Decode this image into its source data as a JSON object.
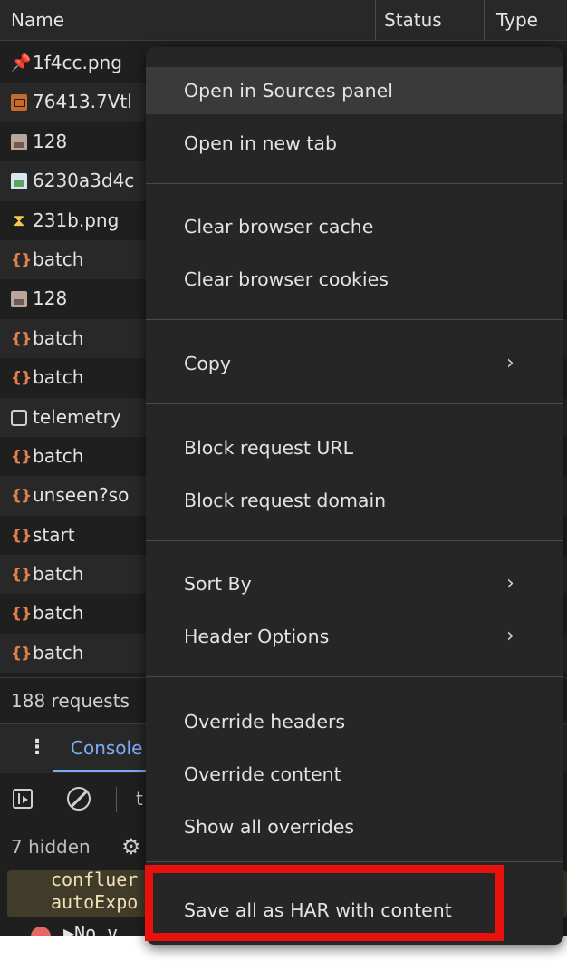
{
  "network": {
    "columns": {
      "name": "Name",
      "status": "Status",
      "type": "Type"
    },
    "rows": [
      {
        "icon": "pin-icon",
        "name": "1f4cc.png"
      },
      {
        "icon": "document-icon",
        "name": "76413.7Vtl"
      },
      {
        "icon": "image-icon",
        "name": "128"
      },
      {
        "icon": "image-icon",
        "name": "6230a3d4c"
      },
      {
        "icon": "hourglass-icon",
        "name": "231b.png"
      },
      {
        "icon": "fetch-icon",
        "name": "batch"
      },
      {
        "icon": "image-icon",
        "name": "128"
      },
      {
        "icon": "fetch-icon",
        "name": "batch"
      },
      {
        "icon": "fetch-icon",
        "name": "batch"
      },
      {
        "icon": "checkbox-icon",
        "name": "telemetry"
      },
      {
        "icon": "fetch-icon",
        "name": "batch"
      },
      {
        "icon": "fetch-icon",
        "name": "unseen?so"
      },
      {
        "icon": "fetch-icon",
        "name": "start"
      },
      {
        "icon": "fetch-icon",
        "name": "batch"
      },
      {
        "icon": "fetch-icon",
        "name": "batch"
      },
      {
        "icon": "fetch-icon",
        "name": "batch"
      }
    ],
    "status_text": "188 requests"
  },
  "drawer": {
    "tab_label": "Console",
    "toolbar_text": "t",
    "hidden_text": "7 hidden",
    "warning_line1": "confluer",
    "warning_line2": "autoExpo",
    "error_line": "▶No v"
  },
  "context_menu": {
    "items": [
      {
        "label": "Open in Sources panel"
      },
      {
        "label": "Open in new tab"
      },
      {
        "label": "Clear browser cache"
      },
      {
        "label": "Clear browser cookies"
      },
      {
        "label": "Copy",
        "chevron": "›"
      },
      {
        "label": "Block request URL"
      },
      {
        "label": "Block request domain"
      },
      {
        "label": "Sort By",
        "chevron": "›"
      },
      {
        "label": "Header Options",
        "chevron": "›"
      },
      {
        "label": "Override headers"
      },
      {
        "label": "Override content"
      },
      {
        "label": "Show all overrides"
      },
      {
        "label": "Save all as HAR with content"
      }
    ]
  },
  "colors": {
    "highlight_border": "#e8110c",
    "menu_bg": "#262626",
    "panel_bg": "#1f1f1f",
    "accent": "#7cacf8"
  }
}
